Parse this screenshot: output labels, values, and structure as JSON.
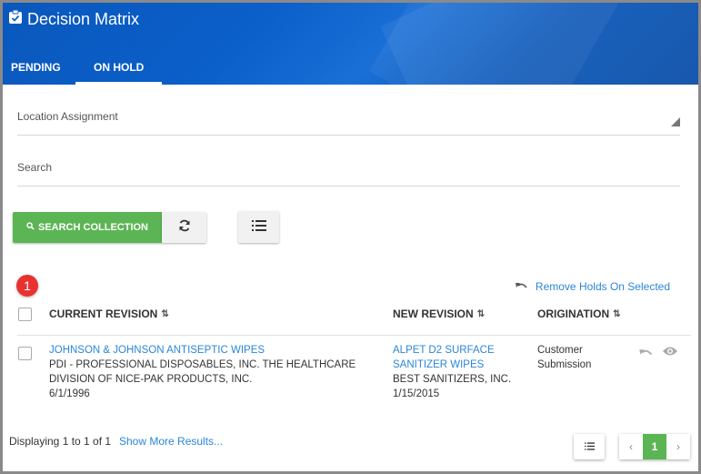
{
  "app": {
    "title": "Decision Matrix"
  },
  "tabs": [
    {
      "label": "PENDING",
      "active": false
    },
    {
      "label": "ON HOLD",
      "active": true
    }
  ],
  "filters": {
    "location_label": "Location Assignment",
    "search_label": "Search"
  },
  "actions": {
    "search_collection": "SEARCH COLLECTION",
    "remove_holds": "Remove Holds On Selected"
  },
  "annotation_badge": "1",
  "table": {
    "columns": [
      "CURRENT REVISION",
      "NEW REVISION",
      "ORIGINATION"
    ],
    "rows": [
      {
        "current_title": "JOHNSON & JOHNSON ANTISEPTIC WIPES",
        "current_line1": "PDI - PROFESSIONAL DISPOSABLES, INC. THE HEALTHCARE",
        "current_line2": "DIVISION OF NICE-PAK PRODUCTS, INC.",
        "current_date": "6/1/1996",
        "new_title_line1": "ALPET D2 SURFACE",
        "new_title_line2": "SANITIZER WIPES",
        "new_company": "BEST SANITIZERS, INC.",
        "new_date": "1/15/2015",
        "origination_line1": "Customer",
        "origination_line2": "Submission"
      }
    ]
  },
  "footer": {
    "displaying": "Displaying 1 to 1 of 1",
    "show_more": "Show More Results...",
    "page_prev": "‹",
    "page_current": "1",
    "page_next": "›"
  },
  "colors": {
    "header_blue": "#0b5fc9",
    "accent_green": "#5cb554",
    "link_blue": "#2b86d8",
    "badge_red": "#e8322f"
  }
}
